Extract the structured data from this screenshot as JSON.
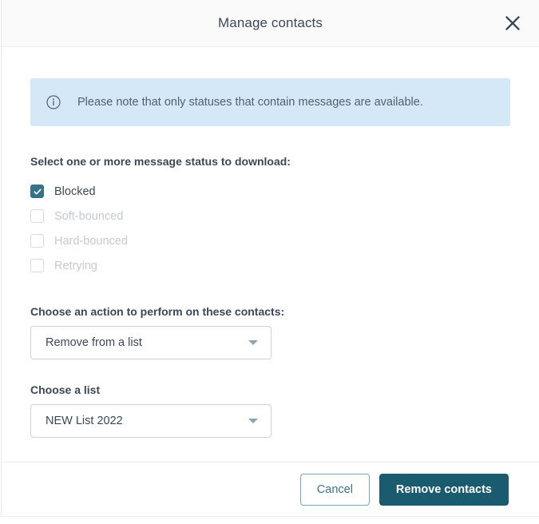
{
  "modal": {
    "title": "Manage contacts",
    "close_icon": "close-icon",
    "banner": {
      "icon": "info-circle-icon",
      "text": "Please note that only statuses that contain messages are available."
    },
    "status_section": {
      "label": "Select one or more message status to download:",
      "options": [
        {
          "label": "Blocked",
          "checked": true,
          "disabled": false
        },
        {
          "label": "Soft-bounced",
          "checked": false,
          "disabled": true
        },
        {
          "label": "Hard-bounced",
          "checked": false,
          "disabled": true
        },
        {
          "label": "Retrying",
          "checked": false,
          "disabled": true
        }
      ]
    },
    "action_field": {
      "label": "Choose an action to perform on these contacts:",
      "value": "Remove from a list",
      "caret_icon": "chevron-down-icon"
    },
    "list_field": {
      "label": "Choose a list",
      "value": "NEW List 2022",
      "caret_icon": "chevron-down-icon"
    },
    "footer": {
      "cancel_label": "Cancel",
      "confirm_label": "Remove contacts"
    }
  },
  "colors": {
    "accent_teal": "#35728a",
    "primary_button": "#1b5b70",
    "banner_bg": "#d4e8f7",
    "text": "#3c4858",
    "disabled_text": "#c5cace"
  }
}
